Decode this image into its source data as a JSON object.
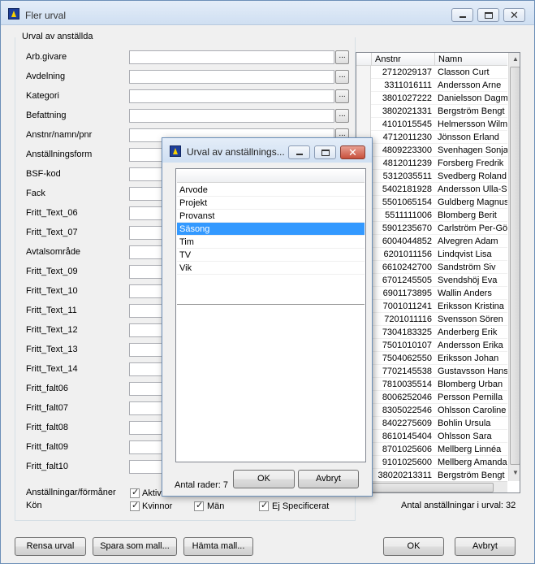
{
  "window": {
    "title": "Fler urval"
  },
  "group": {
    "label": "Urval av anställda"
  },
  "fields": [
    {
      "label": "Arb.givare",
      "has_button": true
    },
    {
      "label": "Avdelning",
      "has_button": true
    },
    {
      "label": "Kategori",
      "has_button": true
    },
    {
      "label": "Befattning",
      "has_button": true
    },
    {
      "label": "Anstnr/namn/pnr",
      "has_button": true
    },
    {
      "label": "Anställningsform",
      "has_button": false
    },
    {
      "label": "BSF-kod",
      "has_button": false
    },
    {
      "label": "Fack",
      "has_button": false
    },
    {
      "label": "Fritt_Text_06",
      "has_button": false
    },
    {
      "label": "Fritt_Text_07",
      "has_button": false
    },
    {
      "label": "Avtalsområde",
      "has_button": false
    },
    {
      "label": "Fritt_Text_09",
      "has_button": false
    },
    {
      "label": "Fritt_Text_10",
      "has_button": false
    },
    {
      "label": "Fritt_Text_11",
      "has_button": false
    },
    {
      "label": "Fritt_Text_12",
      "has_button": false
    },
    {
      "label": "Fritt_Text_13",
      "has_button": false
    },
    {
      "label": "Fritt_Text_14",
      "has_button": false
    },
    {
      "label": "Fritt_falt06",
      "has_button": false
    },
    {
      "label": "Fritt_falt07",
      "has_button": false
    },
    {
      "label": "Fritt_falt08",
      "has_button": false
    },
    {
      "label": "Fritt_falt09",
      "has_button": false
    },
    {
      "label": "Fritt_falt10",
      "has_button": false
    }
  ],
  "dots_label": "...",
  "anstallningar_label": "Anställningar/förmåner",
  "aktiv_label": "Aktiv",
  "kon_label": "Kön",
  "kvinnor_label": "Kvinnor",
  "man_label": "Män",
  "ej_label": "Ej Specificerat",
  "grid": {
    "headers": [
      "Anstnr",
      "Namn"
    ],
    "rows": [
      [
        "2712029137",
        "Classon Curt"
      ],
      [
        "3311016111",
        "Andersson Arne"
      ],
      [
        "3801027222",
        "Danielsson Dagma"
      ],
      [
        "3802021331",
        "Bergström Bengt"
      ],
      [
        "4101015545",
        "Helmersson Wilma"
      ],
      [
        "4712011230",
        "Jönsson Erland"
      ],
      [
        "4809223300",
        "Svenhagen Sonja"
      ],
      [
        "4812011239",
        "Forsberg Fredrik"
      ],
      [
        "5312035511",
        "Svedberg Roland"
      ],
      [
        "5402181928",
        "Andersson Ulla-Sti"
      ],
      [
        "5501065154",
        "Guldberg Magnus"
      ],
      [
        "5511111006",
        "Blomberg Berit"
      ],
      [
        "5901235670",
        "Carlström Per-Göst"
      ],
      [
        "6004044852",
        "Alvegren Adam"
      ],
      [
        "6201011156",
        "Lindqvist Lisa"
      ],
      [
        "6610242700",
        "Sandström Siv"
      ],
      [
        "6701245505",
        "Svendshöj Eva"
      ],
      [
        "6901173895",
        "Wallin Anders"
      ],
      [
        "7001011241",
        "Eriksson Kristina"
      ],
      [
        "7201011116",
        "Svensson Sören"
      ],
      [
        "7304183325",
        "Anderberg Erik"
      ],
      [
        "7501010107",
        "Andersson Erika"
      ],
      [
        "7504062550",
        "Eriksson Johan"
      ],
      [
        "7702145538",
        "Gustavsson Hans"
      ],
      [
        "7810035514",
        "Blomberg Urban"
      ],
      [
        "8006252046",
        "Persson Pernilla"
      ],
      [
        "8305022546",
        "Ohlsson Caroline"
      ],
      [
        "8402275609",
        "Bohlin Ursula"
      ],
      [
        "8610145404",
        "Ohlsson Sara"
      ],
      [
        "8701025606",
        "Mellberg Linnéa"
      ],
      [
        "9101025600",
        "Mellberg Amanda"
      ],
      [
        "38020213311",
        "Bergström Bengt"
      ]
    ]
  },
  "count_text": "Antal anställningar i urval: 32",
  "buttons": {
    "rensa": "Rensa urval",
    "spara": "Spara som mall...",
    "hamta": "Hämta mall...",
    "ok": "OK",
    "avbryt": "Avbryt"
  },
  "dialog": {
    "title": "Urval av anställnings...",
    "items": [
      "Arvode",
      "Projekt",
      "Provanst",
      "Säsong",
      "Tim",
      "TV",
      "Vik"
    ],
    "selected_index": 3,
    "count_text": "Antal rader: 7",
    "ok": "OK",
    "cancel": "Avbryt"
  }
}
